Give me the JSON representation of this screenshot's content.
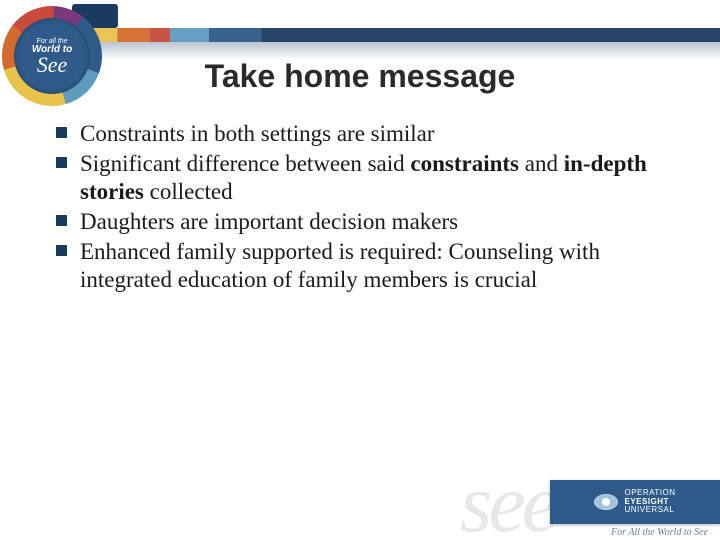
{
  "title": "Take home message",
  "logo_top": {
    "line1": "For all the",
    "line2": "World to",
    "line3": "See"
  },
  "bullets": [
    {
      "text": "Constraints in both settings are similar"
    },
    {
      "pre": "Significant  difference between said ",
      "b1": "constraints",
      "mid": " and ",
      "b2": "in-depth stories",
      "post": " collected"
    },
    {
      "text": "Daughters are important decision makers"
    },
    {
      "text": "Enhanced family supported is required: Counseling with integrated education of family members is crucial"
    }
  ],
  "footer": {
    "watermark": "see",
    "org_line1": "OPERATION",
    "org_line2": "EYESIGHT",
    "org_line3": "UNIVERSAL",
    "tagline": "For All the World to See"
  }
}
